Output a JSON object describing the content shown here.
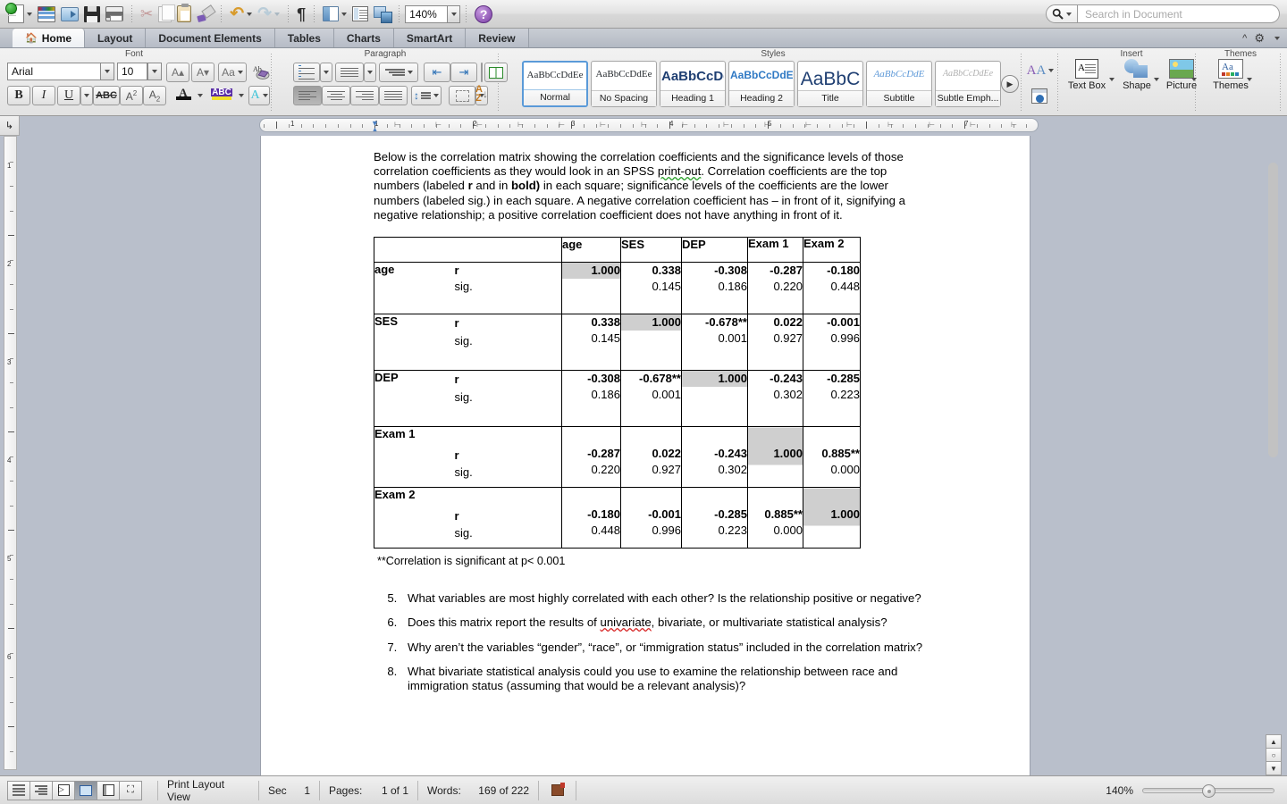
{
  "app": {
    "zoom_toolbar": "140%",
    "search_placeholder": "Search in Document"
  },
  "toolbar": {
    "icons": [
      {
        "name": "new-document-icon",
        "label": "New"
      },
      {
        "name": "open-gallery-icon",
        "label": "Document Gallery"
      },
      {
        "name": "open-folder-icon",
        "label": "Open"
      },
      {
        "name": "save-icon",
        "label": "Save"
      },
      {
        "name": "print-icon",
        "label": "Print"
      },
      {
        "name": "cut-icon",
        "label": "Cut"
      },
      {
        "name": "copy-icon",
        "label": "Copy"
      },
      {
        "name": "paste-icon",
        "label": "Paste"
      },
      {
        "name": "format-painter-icon",
        "label": "Format"
      },
      {
        "name": "undo-icon",
        "label": "Undo"
      },
      {
        "name": "redo-icon",
        "label": "Redo"
      },
      {
        "name": "show-formatting-icon",
        "label": "Show"
      },
      {
        "name": "sidebar-pane-icon",
        "label": "Sidebar"
      },
      {
        "name": "notebook-layout-icon",
        "label": "Notebook"
      },
      {
        "name": "media-browser-icon",
        "label": "Media"
      },
      {
        "name": "help-icon",
        "label": "Help"
      }
    ]
  },
  "tabs": [
    {
      "label": "Home",
      "active": true
    },
    {
      "label": "Layout",
      "active": false
    },
    {
      "label": "Document Elements",
      "active": false
    },
    {
      "label": "Tables",
      "active": false
    },
    {
      "label": "Charts",
      "active": false
    },
    {
      "label": "SmartArt",
      "active": false
    },
    {
      "label": "Review",
      "active": false
    }
  ],
  "ribbon": {
    "groups": [
      "Font",
      "Paragraph",
      "Styles",
      "Insert",
      "Themes"
    ],
    "font": {
      "name": "Arial",
      "size": "10",
      "buttons": [
        "grow-font",
        "shrink-font",
        "change-case",
        "clear-formatting",
        "bold",
        "italic",
        "underline",
        "strikethrough",
        "superscript",
        "subscript",
        "font-color",
        "highlight",
        "text-effects"
      ]
    },
    "paragraph": {
      "buttons": [
        "bulleted-list",
        "numbered-list",
        "multilevel-list",
        "decrease-indent",
        "increase-indent",
        "columns",
        "align-left",
        "align-center",
        "align-right",
        "justify",
        "line-spacing",
        "borders",
        "sort"
      ]
    },
    "styles": [
      {
        "preview": "AaBbCcDdEe",
        "name": "Normal",
        "selected": true
      },
      {
        "preview": "AaBbCcDdEe",
        "name": "No Spacing",
        "selected": false
      },
      {
        "preview": "AaBbCcDd",
        "name": "Heading 1",
        "selected": false
      },
      {
        "preview": "AaBbCcDdEe",
        "name": "Heading 2",
        "selected": false
      },
      {
        "preview": "AaBbC",
        "name": "Title",
        "selected": false
      },
      {
        "preview": "AaBbCcDdE",
        "name": "Subtitle",
        "selected": false
      },
      {
        "preview": "AaBbCcDdEe",
        "name": "Subtle Emph...",
        "selected": false
      }
    ],
    "insert": [
      {
        "name": "text-box-button",
        "label": "Text Box"
      },
      {
        "name": "shape-button",
        "label": "Shape"
      },
      {
        "name": "picture-button",
        "label": "Picture"
      }
    ],
    "themes": [
      {
        "name": "themes-button",
        "label": "Themes"
      }
    ]
  },
  "ruler": {
    "h_numbers": [
      "1",
      "1",
      "2",
      "3",
      "4",
      "5",
      "7"
    ],
    "v_numbers": [
      "1",
      "2",
      "3",
      "4",
      "5",
      "6"
    ]
  },
  "document": {
    "intro": {
      "p1_a": "Below is the correlation matrix showing the correlation coefficients and the significance levels of those correlation coefficients as they would look in an SPSS ",
      "p1_spell": "print-out",
      "p1_b": ".  Correlation coefficients are the top numbers (labeled ",
      "p1_r": "r",
      "p1_c": " and in ",
      "p1_bold": "bold)",
      "p1_d": " in each square; significance levels of the coefficients are the lower numbers (labeled sig.) in each square.  A negative correlation coefficient has – in front of it, signifying a negative relationship; a positive correlation coefficient does not have anything in front of it."
    },
    "footnote": "**Correlation is significant at p< 0.001",
    "questions": [
      {
        "num": "5.",
        "text": "What variables are most highly correlated with each other?  Is the relationship positive or negative?"
      },
      {
        "num": "6.",
        "pre": "Does this matrix report the results of ",
        "spell": "univariate",
        "post": ", bivariate, or multivariate statistical analysis?"
      },
      {
        "num": "7.",
        "text": "Why aren’t the variables “gender”, “race”, or “immigration status” included in the correlation matrix?"
      },
      {
        "num": "8.",
        "text": "What bivariate statistical analysis could you use to examine the relationship between race and immigration status (assuming that would be a relevant analysis)?"
      }
    ]
  },
  "chart_data": {
    "type": "table",
    "title": "Correlation matrix (SPSS print-out style)",
    "columns": [
      "",
      "",
      "age",
      "SES",
      "DEP",
      "Exam 1",
      "Exam 2"
    ],
    "variables": [
      "age",
      "SES",
      "DEP",
      "Exam 1",
      "Exam 2"
    ],
    "stat_labels": [
      "r",
      "sig."
    ],
    "rows": [
      {
        "variable": "age",
        "r": [
          "1.000",
          "0.338",
          "-0.308",
          "-0.287",
          "-0.180"
        ],
        "sig": [
          "",
          "0.145",
          "0.186",
          "0.220",
          "0.448"
        ],
        "diagonal_index": 0
      },
      {
        "variable": "SES",
        "r": [
          "0.338",
          "1.000",
          "-0.678**",
          "0.022",
          "-0.001"
        ],
        "sig": [
          "0.145",
          "",
          "0.001",
          "0.927",
          "0.996"
        ],
        "diagonal_index": 1
      },
      {
        "variable": "DEP",
        "r": [
          "-0.308",
          "-0.678**",
          "1.000",
          "-0.243",
          "-0.285"
        ],
        "sig": [
          "0.186",
          "0.001",
          "",
          "0.302",
          "0.223"
        ],
        "diagonal_index": 2
      },
      {
        "variable": "Exam 1",
        "r": [
          "-0.287",
          "0.022",
          "-0.243",
          "1.000",
          "0.885**"
        ],
        "sig": [
          "0.220",
          "0.927",
          "0.302",
          "",
          "0.000"
        ],
        "diagonal_index": 3
      },
      {
        "variable": "Exam 2",
        "r": [
          "-0.180",
          "-0.001",
          "-0.285",
          "0.885**",
          "1.000"
        ],
        "sig": [
          "0.448",
          "0.996",
          "0.223",
          "0.000",
          ""
        ],
        "diagonal_index": 4
      }
    ],
    "note": "**Correlation is significant at p< 0.001",
    "diagonal_shading_color": "#cfcfcf"
  },
  "statusbar": {
    "view_buttons": [
      "draft-view",
      "outline-view",
      "publishing-layout-view",
      "print-layout-view",
      "notebook-layout-view",
      "full-screen-view"
    ],
    "active_view_index": 3,
    "view_label": "Print Layout View",
    "sec_label": "Sec",
    "sec_value": "1",
    "pages_label": "Pages:",
    "pages_value": "1 of 1",
    "words_label": "Words:",
    "words_value": "169 of 222",
    "zoom_value": "140%"
  }
}
